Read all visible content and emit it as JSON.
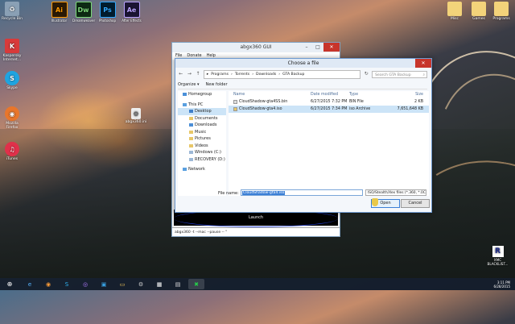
{
  "desktop": {
    "left_icons": [
      {
        "label": "Recycle Bin",
        "icon": "recycle-bin-icon",
        "color": "#8aa0b5",
        "glyph": "♻"
      },
      {
        "label": "Kaspersky Internet...",
        "icon": "kaspersky-icon",
        "color": "#d83a3a",
        "glyph": "K"
      },
      {
        "label": "Skype",
        "icon": "skype-icon",
        "color": "#1fa4e0",
        "glyph": "S"
      },
      {
        "label": "Mozilla Firefox",
        "icon": "firefox-icon",
        "color": "#e8762b",
        "glyph": "◉"
      },
      {
        "label": "iTunes",
        "icon": "itunes-icon",
        "color": "#e0304a",
        "glyph": "♫"
      }
    ],
    "middle_icon": {
      "label": "abgx360.ini",
      "icon": "ini-file-icon"
    },
    "right_icons": [
      {
        "label": "Misc",
        "icon": "folder-icon"
      },
      {
        "label": "Games",
        "icon": "folder-icon"
      },
      {
        "label": "Programs",
        "icon": "folder-icon"
      }
    ],
    "apps": [
      {
        "label": "Illustrator",
        "glyph": "Ai",
        "bg": "#2b1a05",
        "fg": "#ff9a00"
      },
      {
        "label": "Dreamweaver",
        "glyph": "Dw",
        "bg": "#0d2a13",
        "fg": "#7dd87a"
      },
      {
        "label": "Photoshop",
        "glyph": "Ps",
        "bg": "#001c2e",
        "fg": "#31a8ff"
      },
      {
        "label": "After Effects",
        "glyph": "Ae",
        "bg": "#1b1433",
        "fg": "#b9a2ff"
      }
    ],
    "watermark": {
      "glyph": "R",
      "label": "XMC BLACKLIST..."
    }
  },
  "bg_window": {
    "title": "abgx360 GUI",
    "menu": [
      "File",
      "Donate",
      "Help"
    ],
    "launch": "Launch",
    "command": "abgx360 -t --mac --pause -- \""
  },
  "dialog": {
    "title": "Choose a file",
    "path": [
      "Programs",
      "Torrents",
      "Downloads",
      "GTA Backup"
    ],
    "search_placeholder": "Search GTA Backup",
    "toolbar": {
      "organize": "Organize ▾",
      "new_folder": "New folder"
    },
    "nav": [
      {
        "label": "Homegroup",
        "level": 0
      },
      {
        "label": "This PC",
        "level": 0
      },
      {
        "label": "Desktop",
        "level": 1,
        "selected": true
      },
      {
        "label": "Documents",
        "level": 1
      },
      {
        "label": "Downloads",
        "level": 1
      },
      {
        "label": "Music",
        "level": 1
      },
      {
        "label": "Pictures",
        "level": 1
      },
      {
        "label": "Videos",
        "level": 1
      },
      {
        "label": "Windows (C:)",
        "level": 1
      },
      {
        "label": "RECOVERY (D:)",
        "level": 1
      },
      {
        "label": "Network",
        "level": 0
      }
    ],
    "columns": [
      "Name",
      "Date modified",
      "Type",
      "Size"
    ],
    "files": [
      {
        "name": "CloudShadow-gta4SS.bin",
        "date": "6/27/2015 7:32 PM",
        "type": "BIN File",
        "size": "2 KB",
        "selected": false
      },
      {
        "name": "CloudShadow-gta4.iso",
        "date": "6/27/2015 7:34 PM",
        "type": "iso Archive",
        "size": "7,651,648 KB",
        "selected": true
      }
    ],
    "file_name_label": "File name:",
    "file_name_value": "CloudShadow-gta4.iso",
    "filter": "ISO/Stealth/Xex files (*.360, *.0C",
    "open": "Open",
    "cancel": "Cancel"
  },
  "taskbar": {
    "items": [
      {
        "icon": "start-hp-icon",
        "glyph": "⊕"
      },
      {
        "icon": "ie-icon",
        "glyph": "e"
      },
      {
        "icon": "firefox-icon",
        "glyph": "◉"
      },
      {
        "icon": "skype-icon",
        "glyph": "S"
      },
      {
        "icon": "chrome-icon",
        "glyph": "◎"
      },
      {
        "icon": "store-icon",
        "glyph": "▣"
      },
      {
        "icon": "explorer-icon",
        "glyph": "▭"
      },
      {
        "icon": "settings-icon",
        "glyph": "⚙"
      },
      {
        "icon": "calculator-icon",
        "glyph": "▦"
      },
      {
        "icon": "notepad-icon",
        "glyph": "▤"
      },
      {
        "icon": "abgx360-icon",
        "glyph": "✖"
      }
    ],
    "time": "3:11 PM",
    "date": "6/28/2015"
  }
}
